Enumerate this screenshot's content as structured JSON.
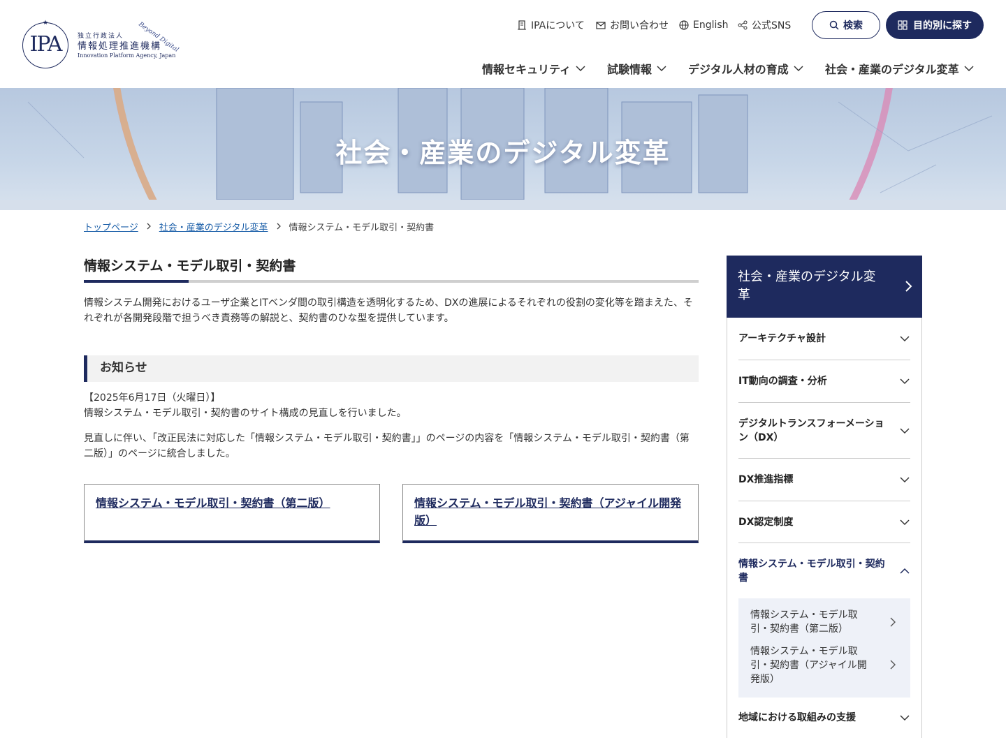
{
  "logo": {
    "small": "独立行政法人",
    "main": "情報処理推進機構",
    "en": "Innovation Platform Agency, Japan",
    "beyond": "Beyond Digital",
    "mark": "IPA"
  },
  "utility": [
    {
      "label": "IPAについて",
      "icon": "building-icon"
    },
    {
      "label": "お問い合わせ",
      "icon": "mail-icon"
    },
    {
      "label": "English",
      "icon": "globe-icon"
    },
    {
      "label": "公式SNS",
      "icon": "share-icon"
    }
  ],
  "buttons": {
    "search": "検索",
    "purpose": "目的別に探す"
  },
  "gnav": [
    "情報セキュリティ",
    "試験情報",
    "デジタル人材の育成",
    "社会・産業のデジタル変革"
  ],
  "hero": {
    "title": "社会・産業のデジタル変革"
  },
  "breadcrumb": {
    "home": "トップページ",
    "parent": "社会・産業のデジタル変革",
    "current": "情報システム・モデル取引・契約書"
  },
  "main": {
    "title": "情報システム・モデル取引・契約書",
    "intro": "情報システム開発におけるユーザ企業とITベンダ間の取引構造を透明化するため、DXの進展によるそれぞれの役割の変化等を踏まえた、それぞれが各開発段階で担うべき責務等の解説と、契約書のひな型を提供しています。",
    "notice_heading": "お知らせ",
    "notice_date": "【2025年6月17日（火曜日）】",
    "notice_p1": "情報システム・モデル取引・契約書のサイト構成の見直しを行いました。",
    "notice_p2": "見直しに伴い、「改正民法に対応した「情報システム・モデル取引・契約書」」のページの内容を「情報システム・モデル取引・契約書（第二版）」のページに統合しました。",
    "cards": [
      "情報システム・モデル取引・契約書（第二版）",
      "情報システム・モデル取引・契約書（アジャイル開発版）"
    ]
  },
  "sidebar": {
    "heading": "社会・産業のデジタル変革",
    "items": [
      "アーキテクチャ設計",
      "IT動向の調査・分析",
      "デジタルトランスフォーメーション（DX）",
      "DX推進指標",
      "DX認定制度",
      "情報システム・モデル取引・契約書",
      "地域における取組みの支援"
    ],
    "sub_items": [
      "情報システム・モデル取引・契約書（第二版）",
      "情報システム・モデル取引・契約書（アジャイル開発版）"
    ]
  },
  "colors": {
    "navy": "#1e2a5e",
    "link": "#1a5ea8"
  }
}
